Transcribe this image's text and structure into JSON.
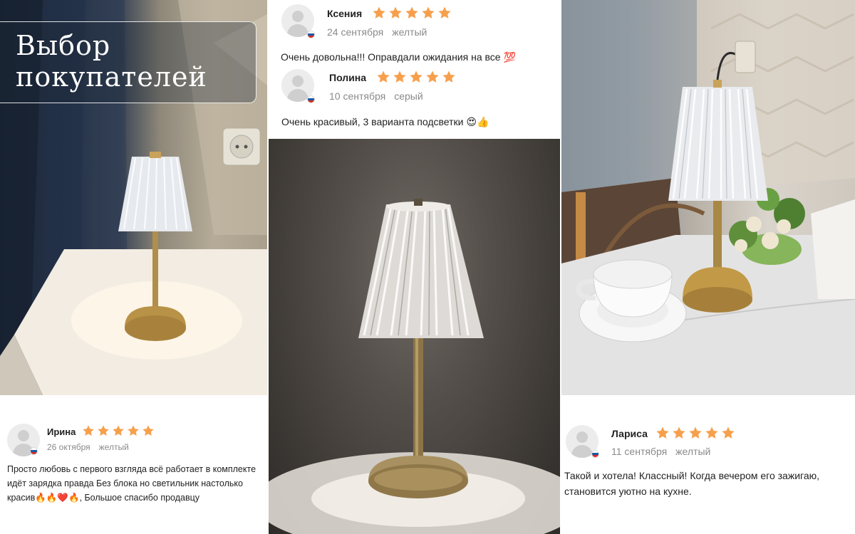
{
  "banner": {
    "title_line1": "Выбор",
    "title_line2": "покупателей"
  },
  "colors": {
    "star": "#f6a04d",
    "meta_text": "#8a8a8a",
    "flag_white": "#ffffff",
    "flag_blue": "#1c57a5",
    "flag_red": "#d52b1e"
  },
  "reviews": [
    {
      "name": "Ксения",
      "rating": 5,
      "date": "24 сентября",
      "variant": "желтый",
      "text": "Очень довольна!!! Оправдали ожидания на все 💯"
    },
    {
      "name": "Полина",
      "rating": 5,
      "date": "10 сентября",
      "variant": "серый",
      "text": "Очень красивый, 3 варианта подсветки 😍👍"
    },
    {
      "name": "Ирина",
      "rating": 5,
      "date": "26 октября",
      "variant": "желтый",
      "text": "Просто любовь с первого взгляда всё работает в комплекте идёт зарядка правда Без блока но светильник настолько красив🔥🔥❤️🔥, Большое спасибо продавцу"
    },
    {
      "name": "Лариса",
      "rating": 5,
      "date": "11 сентября",
      "variant": "желтый",
      "text": "Такой и хотела! Классный! Когда вечером его зажигаю, становится уютно на кухне."
    }
  ]
}
